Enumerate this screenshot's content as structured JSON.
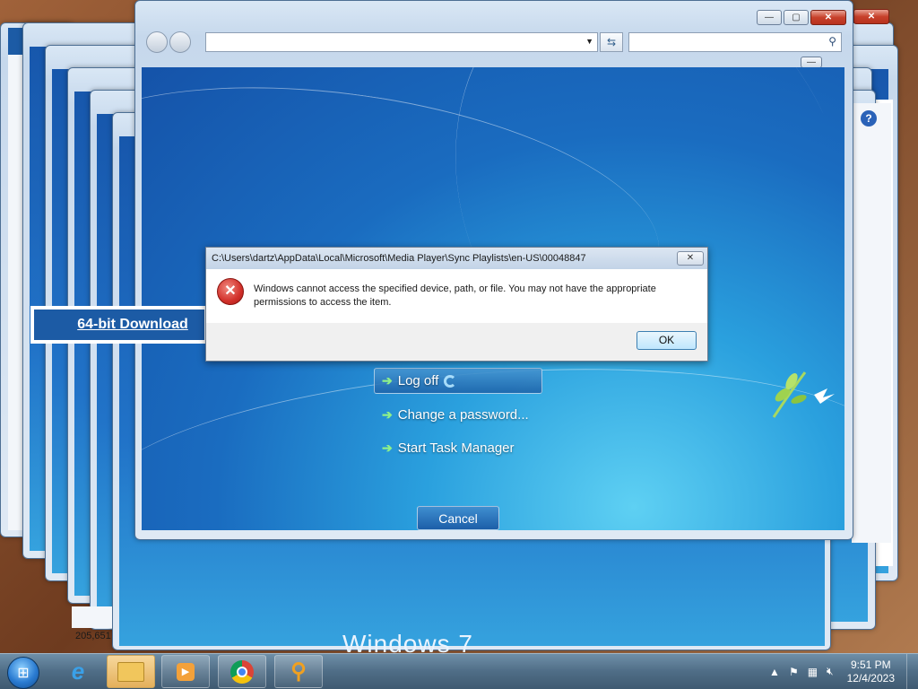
{
  "dialog": {
    "title": "C:\\Users\\dartz\\AppData\\Local\\Microsoft\\Media Player\\Sync Playlists\\en-US\\00048847",
    "message": "Windows cannot access the specified device, path, or file.  You may not have the appropriate permissions to access the item.",
    "ok_label": "OK",
    "close_glyph": "✕"
  },
  "logon": {
    "options": [
      "Log off",
      "Change a password...",
      "Start Task Manager"
    ],
    "cancel_label": "Cancel",
    "brand": "Windows 7"
  },
  "download": {
    "link_label": "64-bit Download"
  },
  "background_window": {
    "status_text": "205,651"
  },
  "browser": {
    "address_value": "",
    "search_value": ""
  },
  "taskbar": {
    "icons": [
      "ie-icon",
      "explorer-icon",
      "media-player-icon",
      "chrome-icon",
      "search-app-icon"
    ],
    "clock_time": "9:51 PM",
    "clock_date": "12/4/2023"
  },
  "colors": {
    "logon_blue": "#1a6cc0",
    "error_red": "#d2302a",
    "taskbar": "#4f6d86"
  }
}
